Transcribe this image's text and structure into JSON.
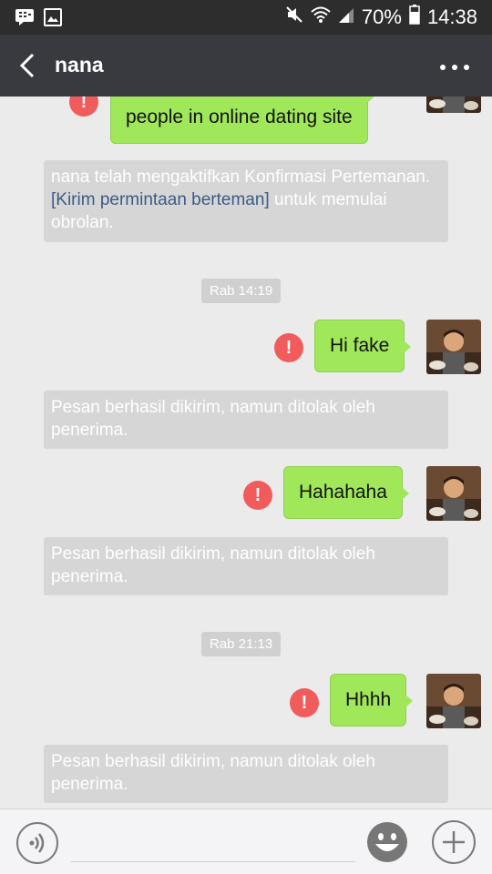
{
  "status_bar": {
    "battery": "70%",
    "time": "14:38",
    "icons": [
      "bbm-icon",
      "gallery-icon",
      "mute-icon",
      "wifi-icon",
      "signal-icon",
      "battery-icon"
    ]
  },
  "header": {
    "title": "nana",
    "back_icon": "chevron-left-icon",
    "more_icon": "more-icon"
  },
  "messages": [
    {
      "type": "sent",
      "text": "people in online dating site",
      "failed": true
    },
    {
      "type": "system",
      "text": "nana telah mengaktifkan Konfirmasi Pertemanan. ",
      "link": "[Kirim permintaan berteman]",
      "text_after": " untuk memulai obrolan."
    },
    {
      "type": "timestamp",
      "text": "Rab 14:19"
    },
    {
      "type": "sent",
      "text": "Hi fake",
      "failed": true
    },
    {
      "type": "system",
      "text": "Pesan berhasil dikirim, namun ditolak oleh penerima."
    },
    {
      "type": "sent",
      "text": "Hahahaha",
      "failed": true
    },
    {
      "type": "system",
      "text": "Pesan berhasil dikirim, namun ditolak oleh penerima."
    },
    {
      "type": "timestamp",
      "text": "Rab 21:13"
    },
    {
      "type": "sent",
      "text": "Hhhh",
      "failed": true
    },
    {
      "type": "system",
      "text": "Pesan berhasil dikirim, namun ditolak oleh penerima."
    }
  ],
  "error_mark": "!",
  "input_bar": {
    "placeholder": "",
    "icons": [
      "voice-icon",
      "emoji-icon",
      "plus-icon"
    ]
  },
  "colors": {
    "bubble": "#a0e759",
    "header": "#393a3f",
    "error": "#f25b5b",
    "link": "#3c5b86"
  }
}
